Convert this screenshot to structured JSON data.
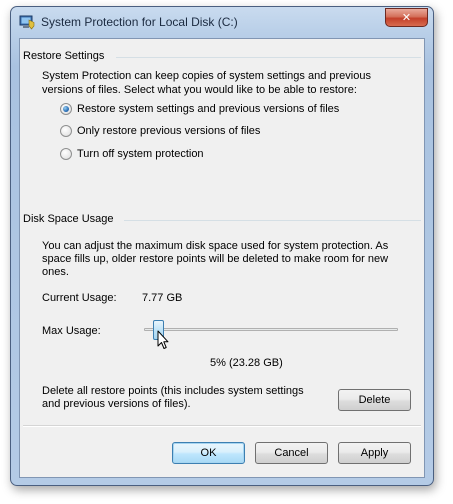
{
  "window": {
    "title": "System Protection for Local Disk (C:)",
    "close_glyph": "✕",
    "icon": "system-protection-icon"
  },
  "restore_settings": {
    "group_title": "Restore Settings",
    "description_line1": "System Protection can keep copies of system settings and previous",
    "description_line2": "versions of files. Select what you would like to be able to restore:",
    "options": [
      {
        "label": "Restore system settings and previous versions of files",
        "checked": true
      },
      {
        "label": "Only restore previous versions of files",
        "checked": false
      },
      {
        "label": "Turn off system protection",
        "checked": false
      }
    ]
  },
  "disk_space_usage": {
    "group_title": "Disk Space Usage",
    "description_line1": "You can adjust the maximum disk space used for system protection. As",
    "description_line2": "space fills up, older restore points will be deleted to make room for new",
    "description_line3": "ones.",
    "current_usage_label": "Current Usage:",
    "current_usage_value": "7.77 GB",
    "max_usage_label": "Max Usage:",
    "max_usage_fraction": 0.05,
    "max_usage_readout": "5% (23.28 GB)",
    "delete_line1": "Delete all restore points (this includes system settings",
    "delete_line2": "and previous versions of files).",
    "delete_button": "Delete"
  },
  "footer": {
    "ok": "OK",
    "cancel": "Cancel",
    "apply": "Apply"
  },
  "colors": {
    "accent_blue": "#3c7fb1",
    "close_red": "#c3402a"
  }
}
